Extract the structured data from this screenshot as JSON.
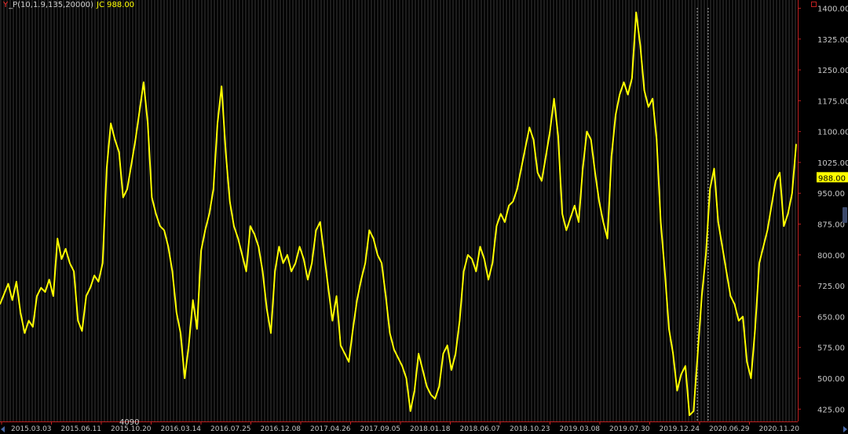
{
  "header": {
    "indicator_mark": "Y",
    "indicator_name": "_P(10,1.9,135,20000)",
    "series_label": "JC 988.00"
  },
  "colors": {
    "background": "#000000",
    "line": "#ffff00",
    "axis": "#c02020",
    "grid": "#3a3a3a",
    "label": "#c8c8c8"
  },
  "chart_data": {
    "type": "line",
    "ylim": [
      395,
      1420
    ],
    "y_ticks": [
      425,
      500,
      575,
      650,
      725,
      800,
      875,
      950,
      1025,
      1100,
      1175,
      1250,
      1325,
      1400
    ],
    "y_tick_labels": [
      "425.00",
      "500.00",
      "575.00",
      "650.00",
      "725.00",
      "800.00",
      "875.00",
      "950.00",
      "1025.00",
      "1100.00",
      "1175.00",
      "1250.00",
      "1325.00",
      "1400.00"
    ],
    "x_labels": [
      "2015.03.03",
      "2015.06.11",
      "2015.10.20",
      "2016.03.14",
      "2016.07.25",
      "2016.12.08",
      "2017.04.26",
      "2017.09.05",
      "2018.01.18",
      "2018.06.07",
      "2018.10.23",
      "2019.03.08",
      "2019.07.30",
      "2019.12.24",
      "2020.06.29",
      "2020.11.20"
    ],
    "last_value": 988,
    "last_value_label": "988.00",
    "low_annotation": "4090",
    "series": [
      {
        "values": [
          680,
          705,
          730,
          690,
          735,
          660,
          610,
          640,
          625,
          700,
          720,
          710,
          740,
          700,
          840,
          790,
          815,
          780,
          760,
          640,
          615,
          700,
          720,
          750,
          735,
          780,
          1010,
          1120,
          1080,
          1050,
          940,
          960,
          1020,
          1080,
          1150,
          1220,
          1120,
          940,
          900,
          870,
          860,
          820,
          760,
          660,
          610,
          500,
          580,
          690,
          620,
          810,
          860,
          900,
          960,
          1120,
          1210,
          1050,
          930,
          870,
          840,
          800,
          760,
          870,
          850,
          820,
          760,
          670,
          610,
          760,
          820,
          780,
          800,
          760,
          780,
          820,
          790,
          740,
          780,
          860,
          880,
          800,
          720,
          640,
          700,
          580,
          560,
          540,
          620,
          690,
          740,
          780,
          860,
          840,
          800,
          780,
          700,
          610,
          570,
          550,
          530,
          500,
          420,
          470,
          560,
          520,
          480,
          460,
          450,
          480,
          560,
          580,
          520,
          560,
          640,
          760,
          800,
          790,
          760,
          820,
          790,
          740,
          780,
          870,
          900,
          880,
          920,
          930,
          960,
          1010,
          1060,
          1110,
          1080,
          1000,
          980,
          1040,
          1100,
          1180,
          1090,
          900,
          860,
          890,
          920,
          880,
          1010,
          1100,
          1080,
          1000,
          930,
          880,
          840,
          1040,
          1140,
          1190,
          1220,
          1190,
          1230,
          1390,
          1310,
          1200,
          1160,
          1180,
          1080,
          880,
          760,
          620,
          560,
          470,
          510,
          530,
          410,
          420,
          560,
          700,
          800,
          960,
          1010,
          880,
          820,
          760,
          700,
          680,
          640,
          650,
          540,
          500,
          620,
          780,
          820,
          860,
          920,
          980,
          1000,
          870,
          900,
          950,
          1070
        ]
      }
    ]
  }
}
